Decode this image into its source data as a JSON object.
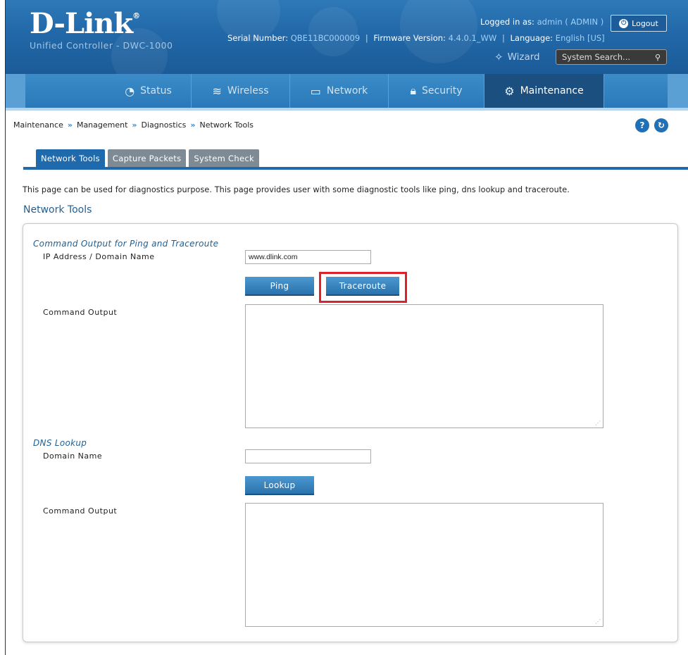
{
  "header": {
    "logo_text": "D-Link",
    "logo_reg": "®",
    "product": "Unified Controller - DWC-1000",
    "logged_in_label": "Logged in as:",
    "logged_in_value": "admin ( ADMIN )",
    "serial_label": "Serial Number:",
    "serial_value": "QBE11BC000009",
    "firmware_label": "Firmware Version:",
    "firmware_value": "4.4.0.1_WW",
    "language_label": "Language:",
    "language_value": "English [US]",
    "logout_label": "Logout",
    "wizard_label": "Wizard",
    "search_placeholder": "System Search..."
  },
  "nav": {
    "items": [
      {
        "label": "Status",
        "icon": "gauge-icon"
      },
      {
        "label": "Wireless",
        "icon": "wifi-icon"
      },
      {
        "label": "Network",
        "icon": "monitor-icon"
      },
      {
        "label": "Security",
        "icon": "lock-icon"
      },
      {
        "label": "Maintenance",
        "icon": "gears-icon"
      }
    ],
    "active": "Maintenance"
  },
  "breadcrumb": [
    "Maintenance",
    "Management",
    "Diagnostics",
    "Network Tools"
  ],
  "breadcrumb_sep": "»",
  "tabs": [
    "Network Tools",
    "Capture Packets",
    "System Check"
  ],
  "active_tab": "Network Tools",
  "description": "This page can be used for diagnostics purpose. This page provides user with some diagnostic tools like ping, dns lookup and traceroute.",
  "section_title": "Network Tools",
  "ping_section": {
    "title": "Command Output for Ping and Traceroute",
    "ip_label": "IP Address / Domain Name",
    "ip_value": "www.dlink.com",
    "ping_button": "Ping",
    "traceroute_button": "Traceroute",
    "output_label": "Command Output",
    "output_value": ""
  },
  "dns_section": {
    "title": "DNS Lookup",
    "domain_label": "Domain Name",
    "domain_value": "",
    "lookup_button": "Lookup",
    "output_label": "Command Output",
    "output_value": ""
  },
  "colors": {
    "header_blue": "#2268a8",
    "nav_active": "#1a4f80",
    "tab_active": "#1f6aad",
    "highlight_red": "#e0202a"
  }
}
